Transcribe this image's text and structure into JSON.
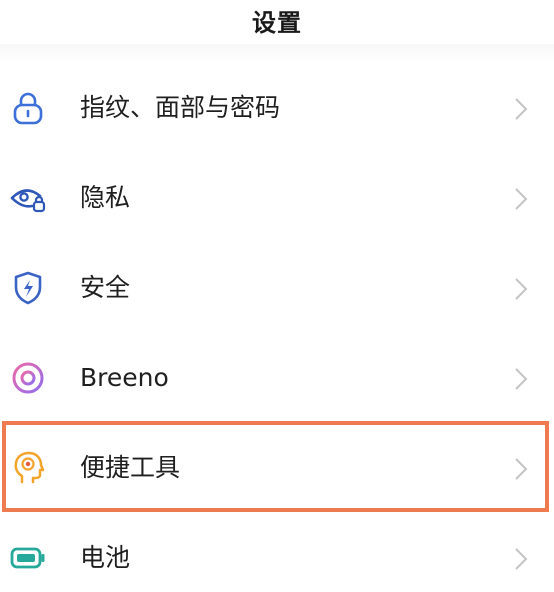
{
  "header": {
    "title": "设置"
  },
  "settings": {
    "items": [
      {
        "label": "指纹、面部与密码",
        "icon": "lock-icon",
        "color": "#3c6fd8"
      },
      {
        "label": "隐私",
        "icon": "eye-lock-icon",
        "color": "#2e57b8"
      },
      {
        "label": "安全",
        "icon": "shield-bolt-icon",
        "color": "#3a63c4"
      },
      {
        "label": "Breeno",
        "icon": "breeno-ring-icon",
        "color": "#b06be0"
      },
      {
        "label": "便捷工具",
        "icon": "head-target-icon",
        "color": "#f3a42a"
      },
      {
        "label": "电池",
        "icon": "battery-icon",
        "color": "#26a99a"
      }
    ]
  },
  "highlight": {
    "item": "便捷工具",
    "color": "#ef7a50"
  }
}
